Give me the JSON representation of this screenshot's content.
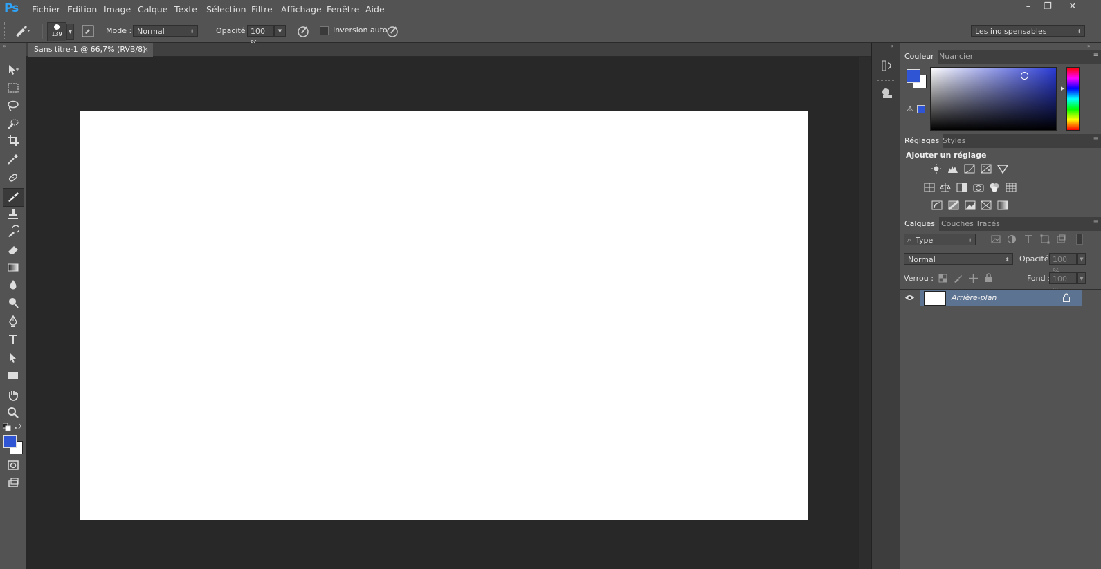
{
  "app": {
    "logo": "Ps"
  },
  "menu": [
    "Fichier",
    "Edition",
    "Image",
    "Calque",
    "Texte",
    "Sélection",
    "Filtre",
    "Affichage",
    "Fenêtre",
    "Aide"
  ],
  "window_buttons": {
    "minimize": "–",
    "restore": "❐",
    "close": "✕"
  },
  "options": {
    "brush_size": "139",
    "mode_label": "Mode :",
    "mode_value": "Normal",
    "opacity_label": "Opacité :",
    "opacity_value": "100 %",
    "inversion_label": "Inversion auto",
    "workspace_value": "Les indispensables"
  },
  "document": {
    "tab_title": "Sans titre-1 @ 66,7% (RVB/8)",
    "close": "×"
  },
  "colors": {
    "foreground": "#2f55d4",
    "background": "#ffffff",
    "accent_blue": "#2a3bd6"
  },
  "color_panel": {
    "tabs": [
      "Couleur",
      "Nuancier"
    ]
  },
  "adjustments_panel": {
    "tabs": [
      "Réglages",
      "Styles"
    ],
    "title": "Ajouter un réglage",
    "icons": [
      "brightness-icon",
      "levels-icon",
      "curves-icon",
      "exposure-icon",
      "vibrance-icon",
      "hue-saturation-icon",
      "color-balance-icon",
      "black-white-icon",
      "photo-filter-icon",
      "channel-mixer-icon",
      "color-lookup-icon",
      "invert-icon",
      "posterize-icon",
      "threshold-icon",
      "selective-color-icon",
      "gradient-map-icon"
    ]
  },
  "layers_panel": {
    "tabs": [
      "Calques",
      "Couches",
      "Tracés"
    ],
    "filter_value": "Type",
    "blend_value": "Normal",
    "opacity_label": "Opacité :",
    "opacity_value": "100 %",
    "lock_label": "Verrou :",
    "fill_label": "Fond :",
    "fill_value": "100 %",
    "layer_name": "Arrière-plan"
  }
}
